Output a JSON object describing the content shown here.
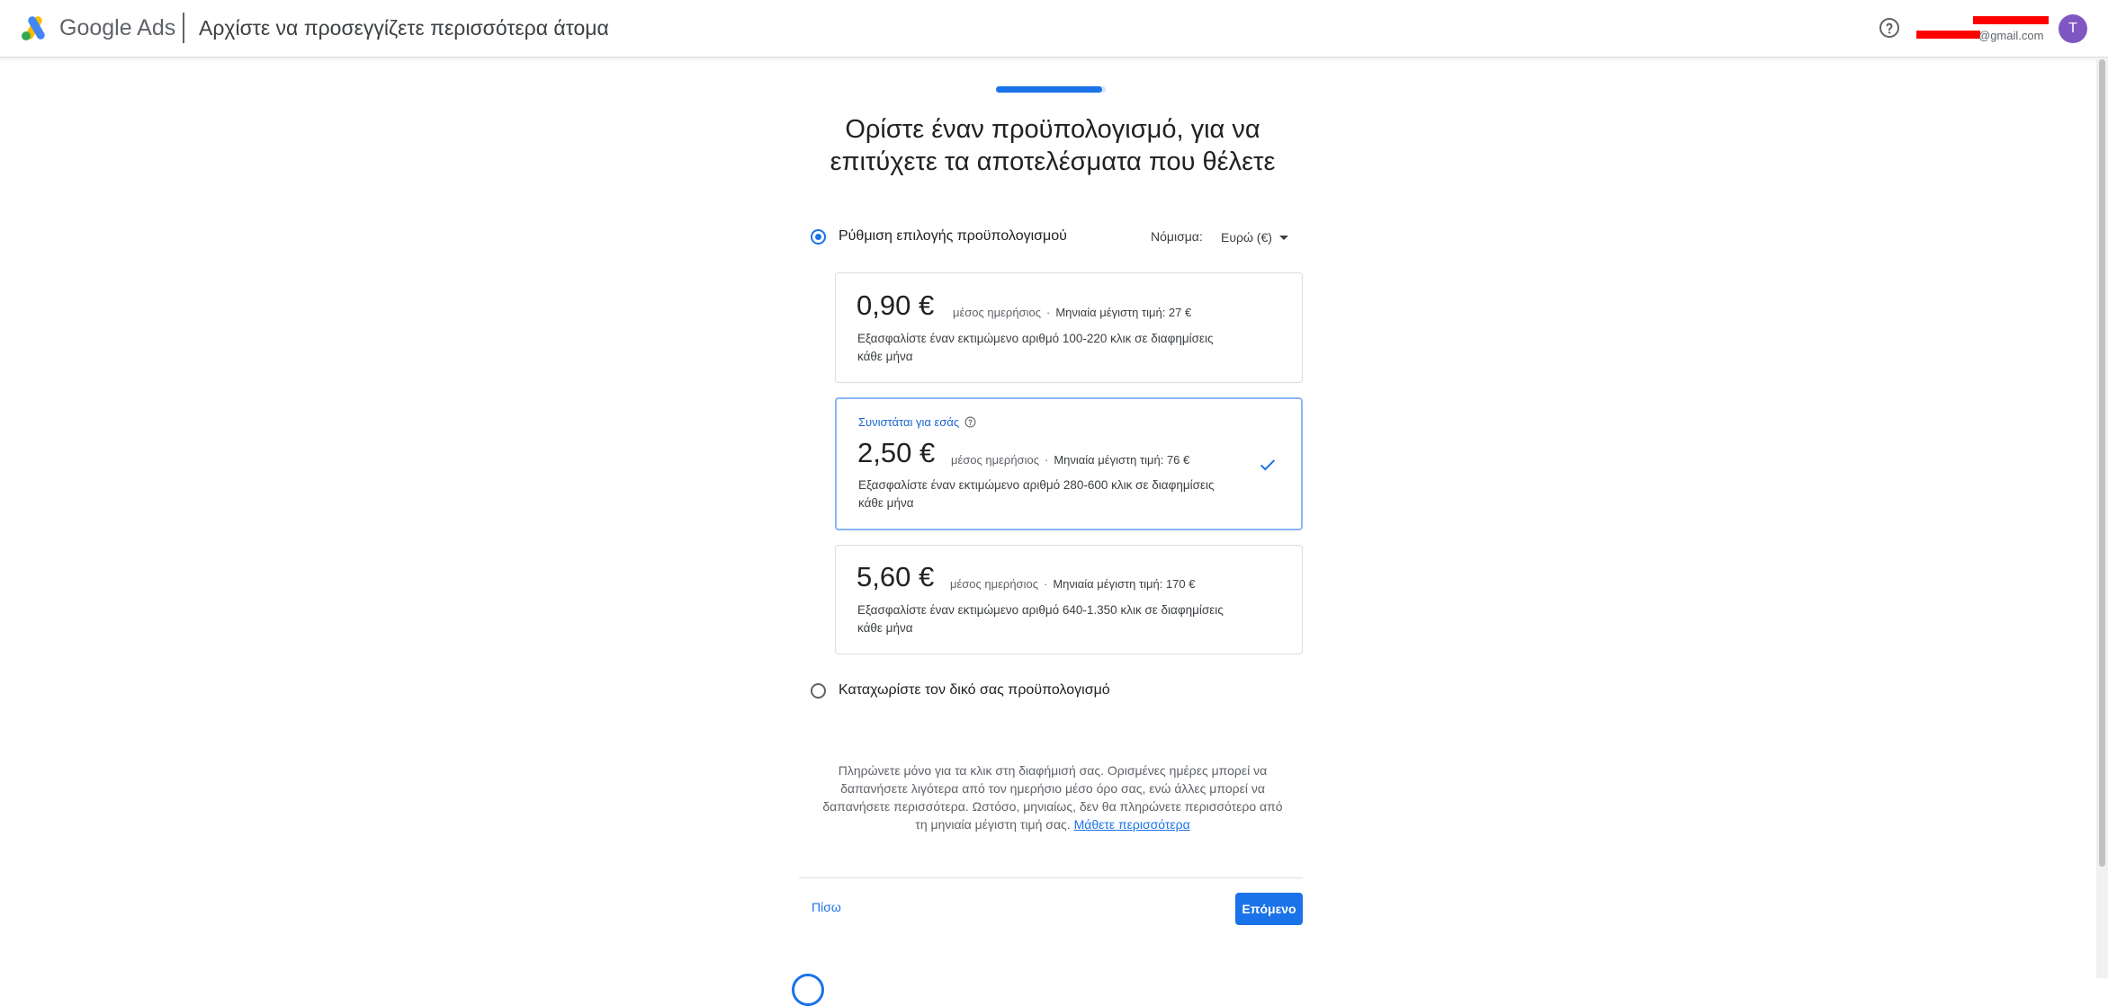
{
  "header": {
    "brand": "Google Ads",
    "title": "Αρχίστε να προσεγγίζετε περισσότερα άτομα",
    "account_email": "@gmail.com",
    "avatar_initial": "T",
    "help_icon": "help-circle-icon"
  },
  "progress": {
    "fraction": 0.97
  },
  "heading": {
    "line1": "Ορίστε έναν προϋπολογισμό, για να",
    "line2": "επιτύχετε τα αποτελέσματα που θέλετε"
  },
  "budget_option": {
    "label": "Ρύθμιση επιλογής προϋπολογισμού",
    "selected": true
  },
  "currency": {
    "label": "Νόμισμα:",
    "value": "Ευρώ (€)"
  },
  "cards": [
    {
      "price": "0,90 €",
      "avg_label": "μέσος ημερήσιος",
      "sep": "·",
      "max_label": "Μηνιαία μέγιστη τιμή: 27 €",
      "desc_line1": "Εξασφαλίστε έναν εκτιμώμενο αριθμό 100-220 κλικ σε διαφημίσεις",
      "desc_line2": "κάθε μήνα",
      "selected": false
    },
    {
      "recommended": "Συνιστάται για εσάς",
      "price": "2,50 €",
      "avg_label": "μέσος ημερήσιος",
      "sep": "·",
      "max_label": "Μηνιαία μέγιστη τιμή: 76 €",
      "desc_line1": "Εξασφαλίστε έναν εκτιμώμενο αριθμό 280-600 κλικ σε διαφημίσεις",
      "desc_line2": "κάθε μήνα",
      "selected": true
    },
    {
      "price": "5,60 €",
      "avg_label": "μέσος ημερήσιος",
      "sep": "·",
      "max_label": "Μηνιαία μέγιστη τιμή: 170 €",
      "desc_line1": "Εξασφαλίστε έναν εκτιμώμενο αριθμό 640-1.350 κλικ σε διαφημίσεις",
      "desc_line2": "κάθε μήνα",
      "selected": false
    }
  ],
  "custom_option": {
    "label": "Καταχωρίστε τον δικό σας προϋπολογισμό",
    "selected": false
  },
  "disclaimer": {
    "line1": "Πληρώνετε μόνο για τα κλικ στη διαφήμισή σας. Ορισμένες ημέρες μπορεί να",
    "line2": "δαπανήσετε λιγότερα από τον ημερήσιο μέσο όρο σας, ενώ άλλες μπορεί να",
    "line3": "δαπανήσετε περισσότερα. Ωστόσο, μηνιαίως, δεν θα πληρώνετε περισσότερο από",
    "line4": "τη μηνιαία μέγιστη τιμή σας.",
    "link": "Μάθετε περισσότερα"
  },
  "footer": {
    "back": "Πίσω",
    "next": "Επόμενο"
  },
  "colors": {
    "primary": "#1a73e8",
    "selected_border": "#8ab4f8",
    "text": "#202124",
    "muted": "#5f6368"
  }
}
